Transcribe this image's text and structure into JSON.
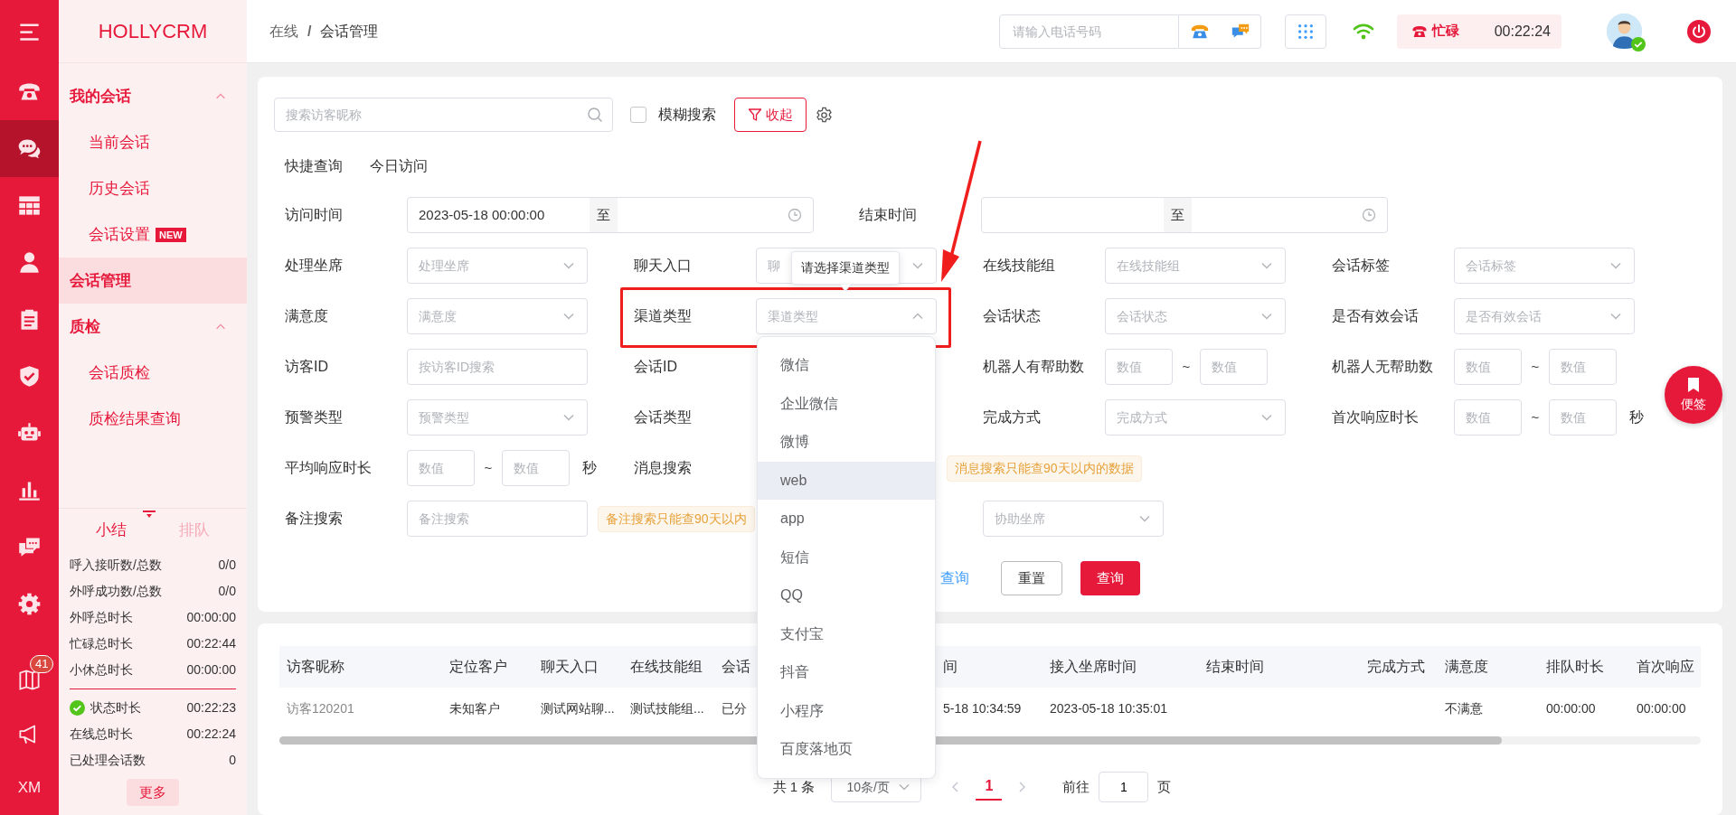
{
  "rail": {
    "items": [
      {
        "selected": false
      },
      {
        "selected": true
      },
      {
        "selected": false
      },
      {
        "selected": false
      },
      {
        "selected": false
      },
      {
        "selected": false
      },
      {
        "selected": false
      },
      {
        "selected": false
      },
      {
        "selected": false
      },
      {
        "selected": false
      }
    ],
    "bottom_items": [
      {
        "badge": "41",
        "selected": false
      },
      {
        "selected": false
      },
      {
        "label": "XM",
        "selected": false
      }
    ]
  },
  "menu": {
    "title": "HOLLYCRM",
    "groups": [
      {
        "label": "我的会话",
        "selected": false,
        "expanded": true,
        "children": [
          {
            "label": "当前会话",
            "selected": false
          },
          {
            "label": "历史会话",
            "selected": false
          },
          {
            "label": "会话设置",
            "badge": "NEW",
            "selected": false
          }
        ]
      },
      {
        "label": "会话管理",
        "selected": true
      },
      {
        "label": "质检",
        "selected": false,
        "expanded": true,
        "children": [
          {
            "label": "会话质检",
            "selected": false
          },
          {
            "label": "质检结果查询",
            "selected": false
          }
        ]
      }
    ]
  },
  "stats_panel": {
    "tabs": [
      {
        "label": "小结",
        "selected": true
      },
      {
        "label": "排队",
        "selected": false
      }
    ],
    "rows": [
      {
        "kind": "plain",
        "label": "呼入接听数/总数",
        "value": "0/0"
      },
      {
        "kind": "plain",
        "label": "外呼成功数/总数",
        "value": "0/0"
      },
      {
        "kind": "plain",
        "label": "外呼总时长",
        "value": "00:00:00"
      },
      {
        "kind": "plain",
        "label": "忙碌总时长",
        "value": "00:22:44"
      },
      {
        "kind": "plain",
        "label": "小休总时长",
        "value": "00:00:00"
      }
    ],
    "session_rows": [
      {
        "kind": "status",
        "label": "状态时长",
        "value": "00:22:23"
      },
      {
        "kind": "plain",
        "label": "在线总时长",
        "value": "00:22:24"
      },
      {
        "kind": "plain",
        "label": "已处理会话数",
        "value": "0"
      }
    ],
    "more_button": "更多"
  },
  "topbar": {
    "breadcrumb": {
      "items": [
        "在线",
        "会话管理"
      ],
      "separator": "/"
    },
    "phone_placeholder": "请输入电话号码",
    "status": {
      "label": "忙碌",
      "timer": "00:22:24"
    },
    "avatar": {
      "online": true
    }
  },
  "search": {
    "placeholder": "搜索访客昵称"
  },
  "fuzzy": {
    "label": "模糊搜索",
    "checked": false
  },
  "collapse_button": "收起",
  "quick": {
    "label": "快捷查询",
    "links": [
      "今日访问"
    ]
  },
  "date_row": [
    {
      "label": "访问时间",
      "start": "2023-05-18 00:00:00",
      "separator": "至"
    },
    {
      "label": "结束时间",
      "separator": "至"
    }
  ],
  "filter_rows": [
    {
      "items": [
        {
          "label": "处理坐席",
          "kind": "select",
          "placeholder": "处理坐席",
          "expanded": false
        },
        {
          "label": "聊天入口",
          "kind": "select",
          "placeholder": "聊",
          "expanded": false
        },
        {
          "label": "在线技能组",
          "kind": "select",
          "placeholder": "在线技能组",
          "expanded": false
        },
        {
          "label": "会话标签",
          "kind": "select",
          "placeholder": "会话标签",
          "expanded": false
        }
      ]
    },
    {
      "items": [
        {
          "label": "满意度",
          "kind": "select",
          "placeholder": "满意度",
          "expanded": false
        },
        {
          "label": "渠道类型",
          "kind": "select",
          "placeholder": "渠道类型",
          "expanded": true
        },
        {
          "label": "会话状态",
          "kind": "select",
          "placeholder": "会话状态",
          "expanded": false
        },
        {
          "label": "是否有效会话",
          "kind": "select",
          "placeholder": "是否有效会话",
          "expanded": false
        }
      ]
    },
    {
      "items": [
        {
          "label": "访客ID",
          "kind": "input",
          "placeholder": "按访客ID搜索"
        },
        {
          "label": "会话ID",
          "kind": "covered"
        },
        {
          "label": "机器人有帮助数",
          "kind": "range",
          "placeholders": [
            "数值",
            "数值"
          ],
          "separator": "~"
        },
        {
          "label": "机器人无帮助数",
          "kind": "range",
          "placeholders": [
            "数值",
            "数值"
          ],
          "separator": "~"
        }
      ]
    },
    {
      "items": [
        {
          "label": "预警类型",
          "kind": "select",
          "placeholder": "预警类型",
          "expanded": false
        },
        {
          "label": "会话类型",
          "kind": "covered"
        },
        {
          "label": "完成方式",
          "kind": "select",
          "placeholder": "完成方式",
          "expanded": false
        },
        {
          "label": "首次响应时长",
          "kind": "range",
          "placeholders": [
            "数值",
            "数值"
          ],
          "separator": "~",
          "unit": "秒"
        }
      ]
    },
    {
      "items": [
        {
          "label": "平均响应时长",
          "kind": "range",
          "placeholders": [
            "数值",
            "数值"
          ],
          "separator": "~",
          "unit": "秒"
        },
        {
          "label": "消息搜索",
          "kind": "covered"
        },
        {
          "kind": "hint",
          "text": "消息搜索只能查90天以内的数据"
        }
      ]
    },
    {
      "items": [
        {
          "label": "备注搜索",
          "kind": "input",
          "placeholder": "备注搜索"
        },
        {
          "kind": "hint",
          "text": "备注搜索只能查90天以内"
        },
        {
          "kind": "select",
          "placeholder": "协助坐席",
          "expanded": false
        }
      ]
    }
  ],
  "actions": {
    "link": "查询",
    "reset": "重置",
    "submit": "查询"
  },
  "tooltip": "请选择渠道类型",
  "dropdown": {
    "options": [
      {
        "label": "微信",
        "hovered": false
      },
      {
        "label": "企业微信",
        "hovered": false
      },
      {
        "label": "微博",
        "hovered": false
      },
      {
        "label": "web",
        "hovered": true
      },
      {
        "label": "app",
        "hovered": false
      },
      {
        "label": "短信",
        "hovered": false
      },
      {
        "label": "QQ",
        "hovered": false
      },
      {
        "label": "支付宝",
        "hovered": false
      },
      {
        "label": "抖音",
        "hovered": false
      },
      {
        "label": "小程序",
        "hovered": false
      },
      {
        "label": "百度落地页",
        "hovered": false
      }
    ]
  },
  "sticky_note": "便签",
  "table": {
    "columns": [
      "访客昵称",
      "定位客户",
      "聊天入口",
      "在线技能组",
      "会话",
      "间",
      "接入坐席时间",
      "结束时间",
      "完成方式",
      "满意度",
      "排队时长",
      "首次响应"
    ],
    "rows": [
      {
        "cells": [
          "访客120201",
          "未知客户",
          "测试网站聊...",
          "测试技能组...",
          "已分",
          "5-18 10:34:59",
          "2023-05-18 10:35:01",
          null,
          null,
          "不满意",
          "00:00:00",
          "00:00:00"
        ]
      }
    ]
  },
  "pagination": {
    "total": "共 1 条",
    "page_size": "10条/页",
    "prev": {
      "disabled": true
    },
    "pages": [
      {
        "label": "1",
        "selected": true
      }
    ],
    "next": {
      "disabled": true
    },
    "goto_label": "前往",
    "goto_value": "1",
    "goto_suffix": "页"
  }
}
